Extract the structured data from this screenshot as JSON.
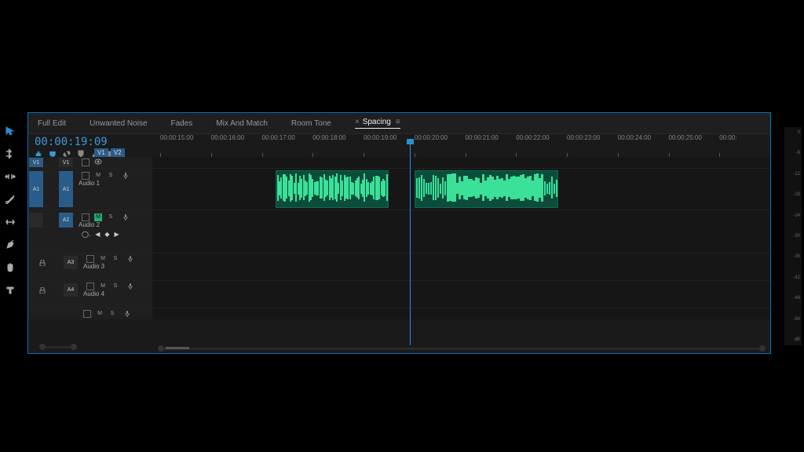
{
  "timecode": "00:00:19:09",
  "tabs": [
    {
      "label": "Full Edit",
      "active": false
    },
    {
      "label": "Unwanted Noise",
      "active": false
    },
    {
      "label": "Fades",
      "active": false
    },
    {
      "label": "Mix And Match",
      "active": false
    },
    {
      "label": "Room Tone",
      "active": false
    },
    {
      "label": "Spacing",
      "active": true
    }
  ],
  "ruler": [
    "00:00:15:00",
    "00:00:16:00",
    "00:00:17:00",
    "00:00:18:00",
    "00:00:19:00",
    "00:00:20:00",
    "00:00:21:00",
    "00:00:22:00",
    "00:00:23:00",
    "00:00:24:00",
    "00:00:25:00",
    "00:00:"
  ],
  "sourcePatches": [
    "V1",
    "V2"
  ],
  "tracks": {
    "video": {
      "source": "V1",
      "target": "V1"
    },
    "audio1": {
      "source": "A1",
      "target": "A1",
      "label": "Audio 1",
      "mute": "M",
      "solo": "S"
    },
    "audio2": {
      "target": "A2",
      "label": "Audio 2",
      "mute": "M",
      "solo": "S",
      "muted": true
    },
    "audio3": {
      "target": "A3",
      "label": "Audio 3",
      "mute": "M",
      "solo": "S"
    },
    "audio4": {
      "target": "A4",
      "label": "Audio 4",
      "mute": "M",
      "solo": "S"
    }
  },
  "playheadPct": 41.5,
  "clips": [
    {
      "leftPct": 20,
      "widthPct": 18
    },
    {
      "leftPct": 42.5,
      "widthPct": 23
    }
  ],
  "meter": [
    "0",
    "-6",
    "-12",
    "-18",
    "-24",
    "-30",
    "-36",
    "-42",
    "-48",
    "-54",
    "dB"
  ],
  "icons": {
    "close": "×",
    "menu": "≡",
    "diamond": "◆",
    "left": "◀",
    "right": "▶"
  }
}
